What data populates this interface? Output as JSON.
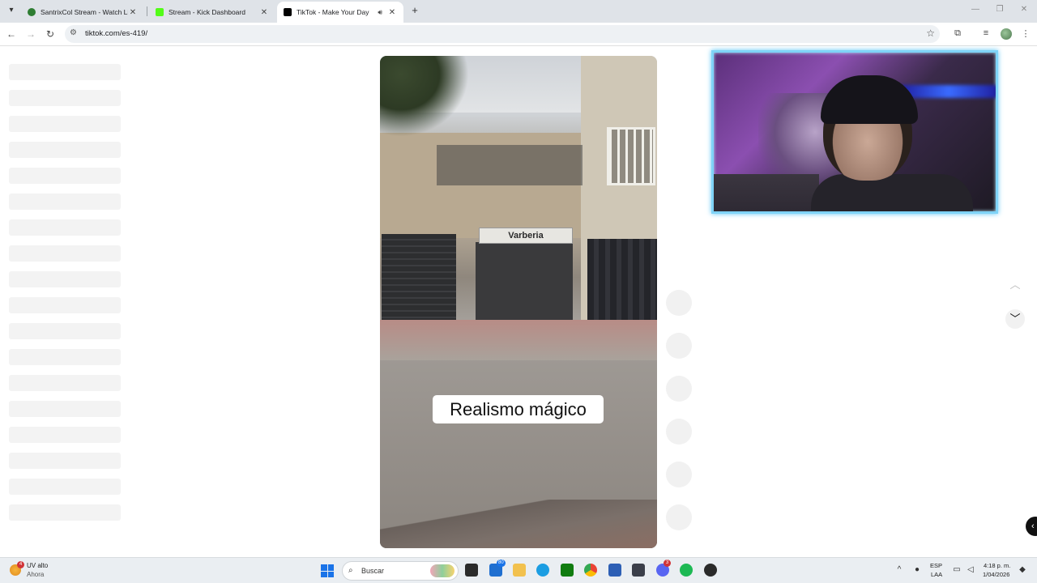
{
  "browser": {
    "tabs": [
      {
        "title": "SantrixCol Stream - Watch Live",
        "active": false,
        "favicon_color": "#2e7d32"
      },
      {
        "title": "Stream - Kick Dashboard",
        "active": false,
        "favicon_color": "#53fc18"
      },
      {
        "title": "TikTok - Make Your Day",
        "active": true,
        "favicon_color": "#000000"
      }
    ],
    "url": "tiktok.com/es-419/"
  },
  "video": {
    "caption": "Realismo mágico",
    "sign_text": "Varberia"
  },
  "taskbar": {
    "weather_title": "UV alto",
    "weather_sub": "Ahora",
    "weather_badge": "4",
    "search_placeholder": "Buscar",
    "store_badge": "80",
    "discord_badge": "3",
    "lang_top": "ESP",
    "lang_bottom": "LAA",
    "time": "4:18 p. m.",
    "date": "1/04/2026"
  },
  "icons": {
    "back": "back-arrow-icon",
    "forward": "forward-arrow-icon",
    "reload": "reload-icon",
    "star": "star-icon",
    "up": "chevron-up-icon",
    "down": "chevron-down-icon"
  }
}
